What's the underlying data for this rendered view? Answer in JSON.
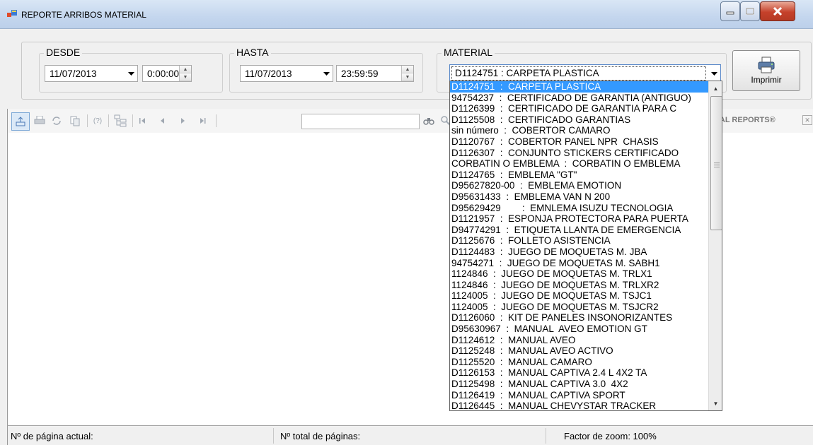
{
  "window": {
    "title": "REPORTE ARRIBOS MATERIAL"
  },
  "filters": {
    "desde": {
      "label": "DESDE",
      "date": "11/07/2013",
      "time": "0:00:00"
    },
    "hasta": {
      "label": "HASTA",
      "date": "11/07/2013",
      "time": "23:59:59"
    },
    "material": {
      "label": "MATERIAL",
      "selected": "D1124751  :  CARPETA PLASTICA",
      "options": [
        "D1124751  :  CARPETA PLASTICA",
        "94754237  :  CERTIFICADO DE GARANTIA (ANTIGUO)",
        "D1126399  :  CERTIFICADO DE GARANTIA PARA C",
        "D1125508  :  CERTIFICADO GARANTIAS",
        "sin número  :  COBERTOR CAMARO",
        "D1120767  :  COBERTOR PANEL NPR  CHASIS",
        "D1126307  :  CONJUNTO STICKERS CERTIFICADO",
        "CORBATIN O EMBLEMA  :  CORBATIN O EMBLEMA",
        "D1124765  :  EMBLEMA \"GT\"",
        "D95627820-00  :  EMBLEMA EMOTION",
        "D95631433  :  EMBLEMA VAN N 200",
        "D95629429        :  EMNLEMA ISUZU TECNOLOGIA",
        "D1121957  :  ESPONJA PROTECTORA PARA PUERTA",
        "D94774291  :  ETIQUETA LLANTA DE EMERGENCIA",
        "D1125676  :  FOLLETO ASISTENCIA",
        "D1124483  :  JUEGO DE MOQUETAS M. JBA",
        "94754271  :  JUEGO DE MOQUETAS M. SABH1",
        "1124846  :  JUEGO DE MOQUETAS M. TRLX1",
        "1124846  :  JUEGO DE MOQUETAS M. TRLXR2",
        "1124005  :  JUEGO DE MOQUETAS M. TSJC1",
        "1124005  :  JUEGO DE MOQUETAS M. TSJCR2",
        "D1126060  :  KIT DE PANELES INSONORIZANTES",
        "D95630967  :  MANUAL  AVEO EMOTION GT",
        "D1124612  :  MANUAL AVEO",
        "D1125248  :  MANUAL AVEO ACTIVO",
        "D1125520  :  MANUAL CAMARO",
        "D1126153  :  MANUAL CAPTIVA 2.4 L 4X2 TA",
        "D1125498  :  MANUAL CAPTIVA 3.0  4X2",
        "D1126419  :  MANUAL CAPTIVA SPORT",
        "D1126445  :  MANUAL CHEVYSTAR TRACKER"
      ]
    }
  },
  "actions": {
    "print_label": "Imprimir"
  },
  "viewer": {
    "brand_text": "TAL REPORTS®",
    "toolbar_icons": [
      "export-icon",
      "print-icon",
      "refresh-icon",
      "copy-icon",
      "help-icon",
      "group-tree-icon",
      "first-page-icon",
      "previous-page-icon",
      "next-page-icon",
      "last-page-icon",
      "find-icon",
      "zoom-icon"
    ]
  },
  "status": {
    "current_page": "Nº de página actual:",
    "total_pages": "Nº total de páginas:",
    "zoom": "Factor de zoom: 100%"
  }
}
